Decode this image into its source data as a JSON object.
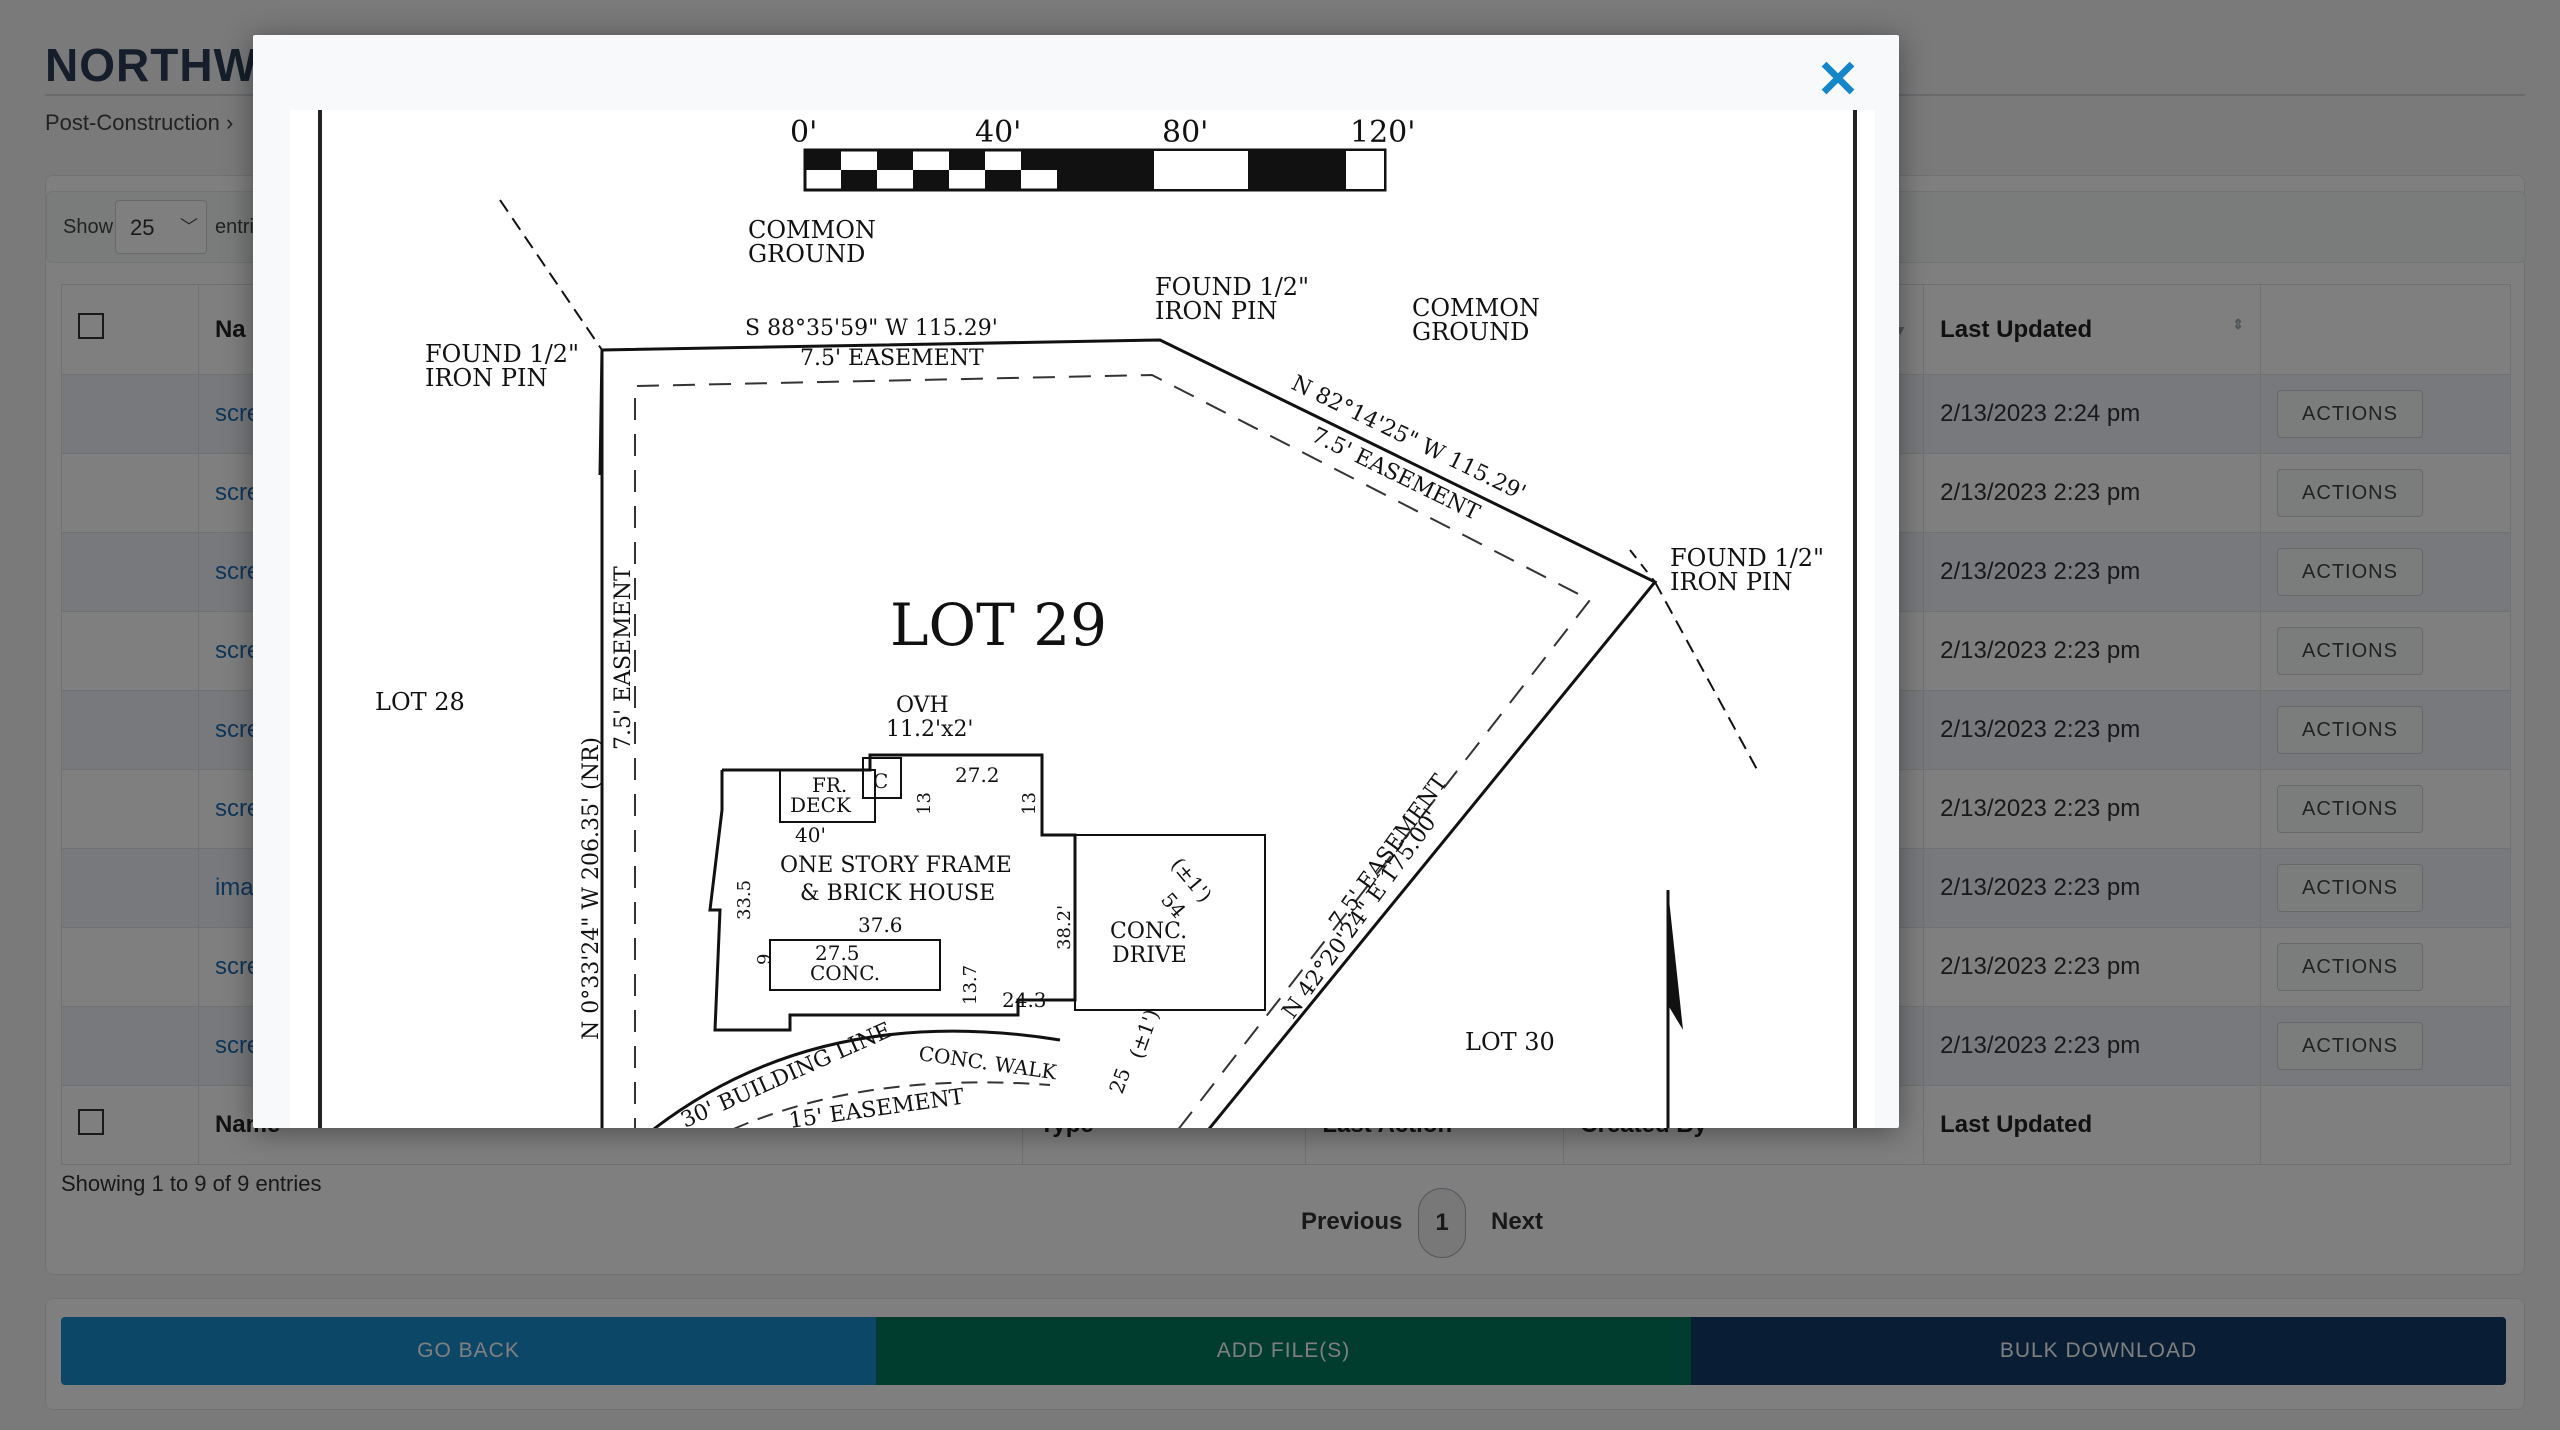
{
  "page": {
    "title": "NORTHWI",
    "breadcrumb": "Post-Construction ›"
  },
  "controls": {
    "show_label": "Show",
    "show_value": "25",
    "entries_label": "entri"
  },
  "table": {
    "headers": {
      "name": "Na",
      "last_updated": "Last Updated"
    },
    "footer": {
      "name": "Name",
      "type": "Type",
      "last_action": "Last Action",
      "created_by": "Created By",
      "last_updated": "Last Updated"
    },
    "rows": [
      {
        "name": "scre",
        "updated": "2/13/2023 2:24 pm",
        "action": "ACTIONS"
      },
      {
        "name": "scre",
        "updated": "2/13/2023 2:23 pm",
        "action": "ACTIONS"
      },
      {
        "name": "scre",
        "updated": "2/13/2023 2:23 pm",
        "action": "ACTIONS"
      },
      {
        "name": "scre",
        "updated": "2/13/2023 2:23 pm",
        "action": "ACTIONS"
      },
      {
        "name": "scre",
        "updated": "2/13/2023 2:23 pm",
        "action": "ACTIONS"
      },
      {
        "name": "scre",
        "updated": "2/13/2023 2:23 pm",
        "action": "ACTIONS"
      },
      {
        "name": "ima",
        "updated": "2/13/2023 2:23 pm",
        "action": "ACTIONS"
      },
      {
        "name": "scre",
        "updated": "2/13/2023 2:23 pm",
        "action": "ACTIONS"
      },
      {
        "name": "scre",
        "updated": "2/13/2023 2:23 pm",
        "action": "ACTIONS"
      }
    ]
  },
  "footer_info": {
    "showing": "Showing 1 to 9 of 9 entries",
    "previous": "Previous",
    "page": "1",
    "next": "Next"
  },
  "bottom_buttons": {
    "go_back": "GO BACK",
    "add_files": "ADD FILE(S)",
    "bulk_download": "BULK DOWNLOAD"
  },
  "modal": {
    "close": "✕",
    "plat": {
      "scale_0": "0'",
      "scale_40": "40'",
      "scale_80": "80'",
      "scale_120": "120'",
      "common_ground": "COMMON",
      "ground": "GROUND",
      "common_ground_2": "COMMON",
      "ground_2": "GROUND",
      "found_1": "FOUND 1/2\"",
      "iron_pin_1": "IRON PIN",
      "found_2": "FOUND 1/2\"",
      "iron_pin_2": "IRON PIN",
      "found_3": "FOUND 1/2\"",
      "iron_pin_3": "IRON PIN",
      "top_bearing": "S 88°35'59\" W   115.29'",
      "top_easement": "7.5' EASEMENT",
      "ne_bearing": "N 82°14'25\" W   115.29'",
      "ne_easement": "7.5' EASEMENT",
      "lot_title": "LOT 29",
      "lot_28": "LOT 28",
      "lot_30": "LOT 30",
      "west_bearing": "N 0°33'24\" W   206.35'   (NR)",
      "west_easement": "7.5' EASEMENT",
      "se_bearing": "N 42°20'24\" E   175.00'",
      "se_easement": "7.5' EASEMENT",
      "ovh": "OVH",
      "ovh_dim": "11.2'x2'",
      "fr": "FR.",
      "deck": "DECK",
      "c": "C",
      "d_27_2": "27.2",
      "d_13a": "13",
      "d_13b": "13",
      "d_40": "40'",
      "house_1": "ONE STORY FRAME",
      "house_2": "& BRICK HOUSE",
      "d_33_5": "33.5",
      "d_37_6": "37.6",
      "d_9": "9",
      "d_27_5": "27.5",
      "conc": "CONC.",
      "d_38_2": "38.2'",
      "d_13_7": "13.7",
      "d_24_3": "24.3",
      "conc_drive_1": "CONC.",
      "conc_drive_2": "DRIVE",
      "pm1a": "(±1')",
      "d_54": "54",
      "pm1b": "(±1')",
      "d_25": "25",
      "building_line": "30' BUILDING LINE",
      "conc_walk": "CONC. WALK",
      "bottom_easement": "15' EASEMENT"
    }
  },
  "colors": {
    "go_back": "#1a8fd1",
    "add_files": "#007a5e",
    "bulk_download": "#123a68",
    "close": "#1487c9"
  }
}
